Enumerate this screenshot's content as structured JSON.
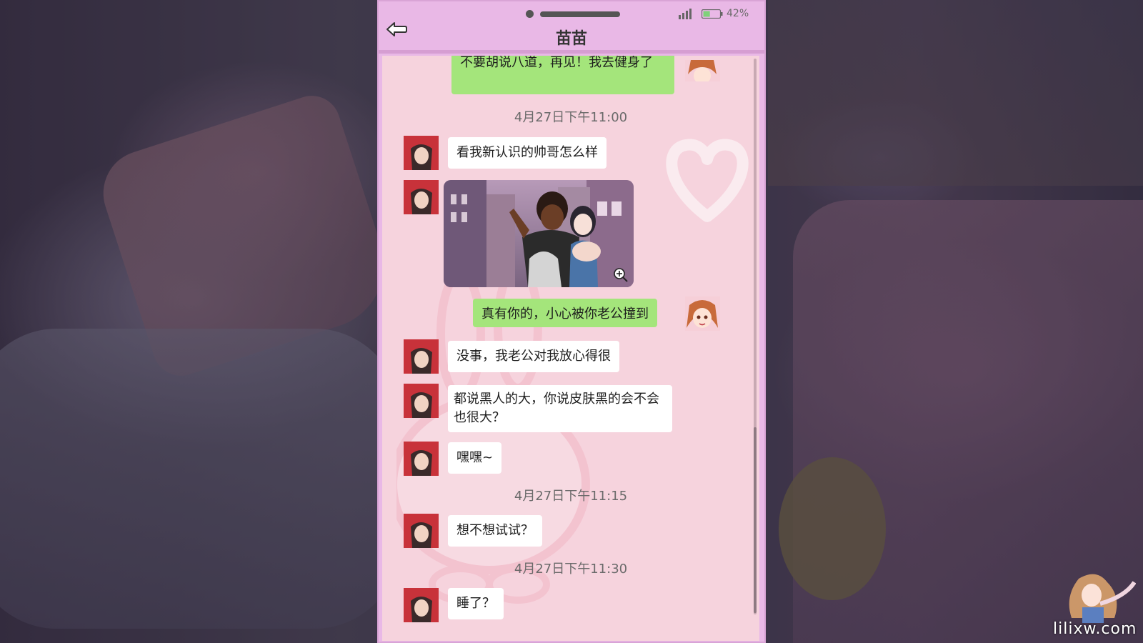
{
  "status_bar": {
    "battery_percent": "42%",
    "battery_level": 0.42,
    "signal_icon": "signal-bars-icon",
    "battery_icon": "battery-icon"
  },
  "header": {
    "contact_name": "苗苗",
    "back_icon": "back-arrow-icon"
  },
  "messages": [
    {
      "sender": "me",
      "text": "不要胡说八道，再见！我去健身了"
    },
    {
      "timestamp": "4月27日下午11:00"
    },
    {
      "sender": "friend",
      "text": "看我新认识的帅哥怎么样"
    },
    {
      "sender": "friend",
      "type": "image",
      "icon": "zoom-in-icon"
    },
    {
      "sender": "me",
      "text": "真有你的，小心被你老公撞到"
    },
    {
      "sender": "friend",
      "text": "没事，我老公对我放心得很"
    },
    {
      "sender": "friend",
      "text": "都说黑人的大，你说皮肤黑的会不会也很大？"
    },
    {
      "sender": "friend",
      "text": "嘿嘿~"
    },
    {
      "timestamp": "4月27日下午11:15"
    },
    {
      "sender": "friend",
      "text": "想不想试试？"
    },
    {
      "timestamp": "4月27日下午11:30"
    },
    {
      "sender": "friend",
      "text": "睡了？"
    }
  ],
  "watermark": {
    "site": "lilixw.com"
  },
  "colors": {
    "phone_frame": "#e9b8e6",
    "chat_background": "#f6d3dd",
    "bubble_incoming": "#ffffff",
    "bubble_outgoing": "#a4e57b",
    "friend_avatar": "#c23b3b"
  }
}
